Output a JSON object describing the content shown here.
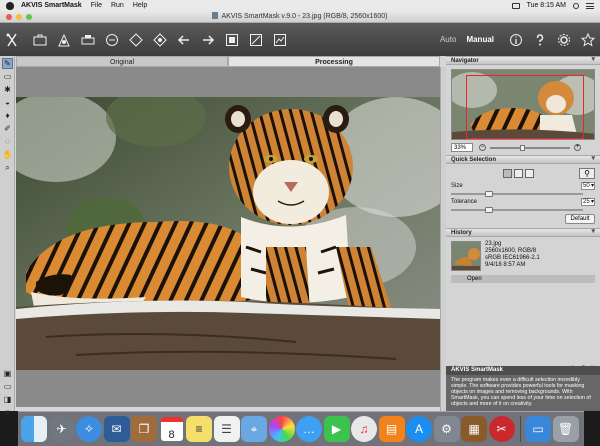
{
  "menubar": {
    "app_name": "AKVIS SmartMask",
    "items": [
      "File",
      "Run",
      "Help"
    ],
    "clock": "Tue 8:15 AM"
  },
  "window": {
    "title": "AKVIS SmartMask v.9.0 - 23.jpg (RGB/8, 2560x1600)"
  },
  "toolbar": {
    "mode_auto": "Auto",
    "mode_manual": "Manual"
  },
  "canvas": {
    "tabs": [
      "Original",
      "Processing"
    ],
    "active_tab": "Processing"
  },
  "navigator": {
    "title": "Navigator",
    "zoom": "33%"
  },
  "quick_selection": {
    "title": "Quick Selection",
    "size_label": "Size",
    "size_value": "50",
    "tolerance_label": "Tolerance",
    "tolerance_value": "25",
    "default_button": "Default"
  },
  "history": {
    "title": "History",
    "filename": "23.jpg",
    "dims": "2560x1600, RGB/8",
    "profile": "sRGB IEC61966-2.1",
    "date": "9/4/18 8:57 AM",
    "open_label": "Open"
  },
  "help": {
    "title": "AKVIS SmartMask",
    "text": "The program makes even a difficult selection incredibly simple. The software provides powerful tools for masking objects on images and removing backgrounds. With SmartMask, you can spend less of your time on selection of objects and more of it on creativity."
  },
  "dock": {
    "calendar_day": "8"
  },
  "colors": {
    "toolbar_bg": "#4a4a4a",
    "panel_bg": "#d4d4d4",
    "canvas_bg": "#8a8a8a",
    "selected_tool": "#8fa7c4"
  }
}
